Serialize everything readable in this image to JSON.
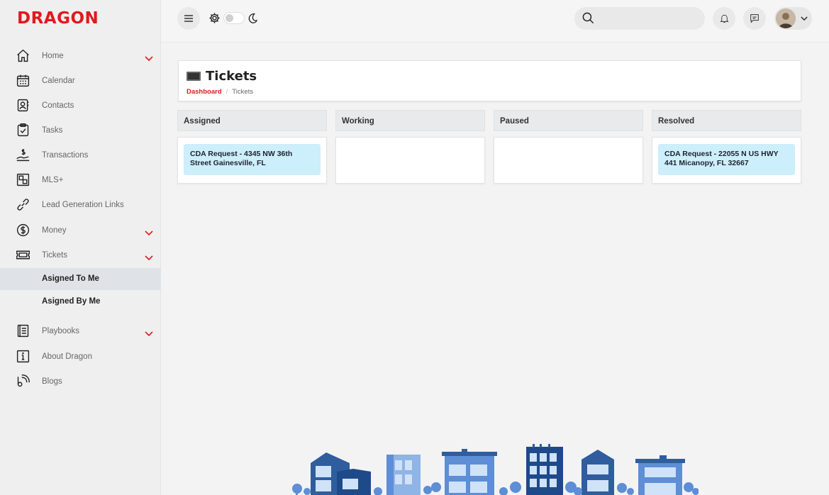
{
  "brand": {
    "name": "DRAGON",
    "accent": "#e0191e"
  },
  "sidebar": {
    "items": [
      {
        "label": "Home",
        "icon": "home-icon",
        "expandable": true
      },
      {
        "label": "Calendar",
        "icon": "calendar-icon",
        "expandable": false
      },
      {
        "label": "Contacts",
        "icon": "contacts-icon",
        "expandable": false
      },
      {
        "label": "Tasks",
        "icon": "clipboard-check-icon",
        "expandable": false
      },
      {
        "label": "Transactions",
        "icon": "hand-dollar-icon",
        "expandable": false
      },
      {
        "label": "MLS+",
        "icon": "mls-icon",
        "expandable": false
      },
      {
        "label": "Lead Generation Links",
        "icon": "link-icon",
        "expandable": false
      },
      {
        "label": "Money",
        "icon": "dollar-circle-icon",
        "expandable": true
      },
      {
        "label": "Tickets",
        "icon": "ticket-icon",
        "expandable": true
      },
      {
        "label": "Playbooks",
        "icon": "book-icon",
        "expandable": true
      },
      {
        "label": "About Dragon",
        "icon": "info-icon",
        "expandable": false
      },
      {
        "label": "Blogs",
        "icon": "rss-icon",
        "expandable": false
      }
    ],
    "tickets_sub": [
      {
        "label": "Asigned To Me",
        "active": true
      },
      {
        "label": "Asigned By Me",
        "active": false
      }
    ]
  },
  "header": {
    "search_placeholder": "",
    "theme_toggle_on": false
  },
  "page": {
    "title": "Tickets",
    "breadcrumb": {
      "root": "Dashboard",
      "current": "Tickets"
    }
  },
  "board": {
    "columns": [
      {
        "title": "Assigned",
        "tickets": [
          "CDA Request - 4345 NW 36th Street Gainesville, FL"
        ]
      },
      {
        "title": "Working",
        "tickets": []
      },
      {
        "title": "Paused",
        "tickets": []
      },
      {
        "title": "Resolved",
        "tickets": [
          "CDA Request - 22055 N US HWY 441 Micanopy, FL 32667"
        ]
      }
    ]
  }
}
